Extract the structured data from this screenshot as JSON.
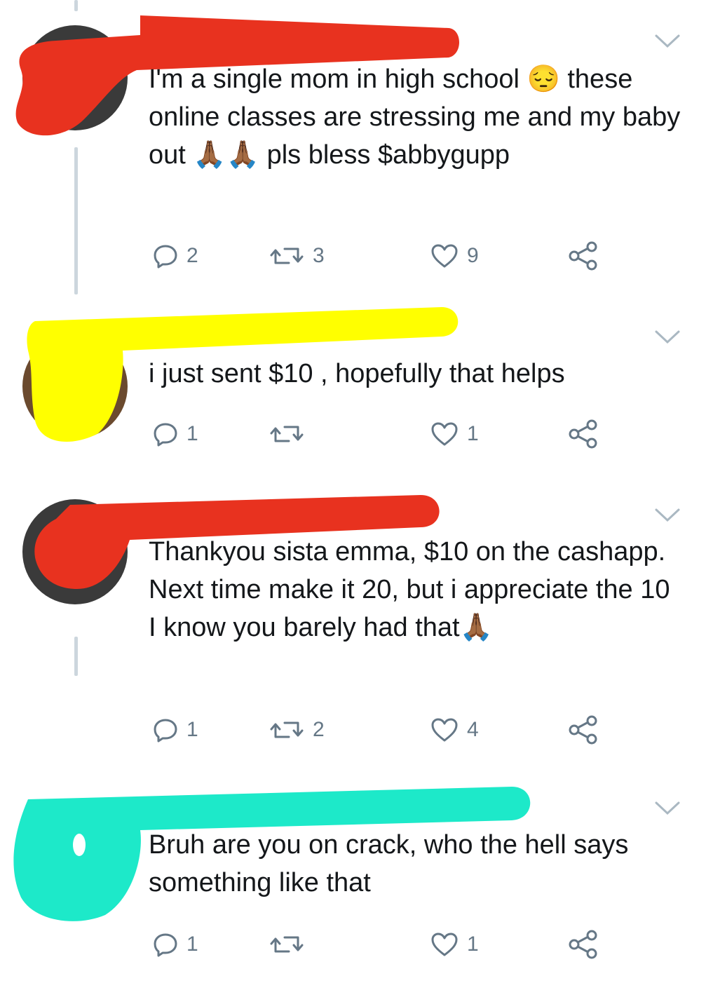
{
  "tweets": [
    {
      "text": "I'm a single mom in high school 😔 these online classes are stressing me and my baby out 🙏🏾🙏🏾 pls bless $abbygupp",
      "replies": "2",
      "retweets": "3",
      "likes": "9"
    },
    {
      "text": "i just sent $10 , hopefully that helps",
      "replies": "1",
      "retweets": "",
      "likes": "1"
    },
    {
      "text": "Thankyou sista emma, $10 on the cashapp. Next time make it 20, but i appreciate the 10 I know you barely had that🙏🏾",
      "replies": "1",
      "retweets": "2",
      "likes": "4"
    },
    {
      "text": "Bruh are you on crack, who the hell says something like that",
      "replies": "1",
      "retweets": "",
      "likes": "1"
    }
  ],
  "colors": {
    "redact_red": "#e8321f",
    "redact_yellow": "#ffff00",
    "redact_teal": "#1de9c9",
    "icon_gray": "#657786",
    "thread_line": "#ccd6dd"
  },
  "icons": [
    "chevron-down-icon",
    "reply-icon",
    "retweet-icon",
    "like-icon",
    "share-icon"
  ]
}
